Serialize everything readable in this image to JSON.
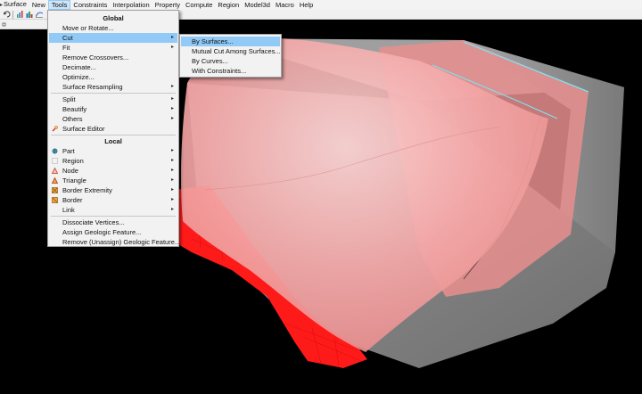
{
  "menubar": {
    "items": [
      "Surface",
      "New",
      "Tools",
      "Constraints",
      "Interpolation",
      "Property",
      "Compute",
      "Region",
      "Model3d",
      "Macro",
      "Help"
    ],
    "active_index": 2
  },
  "tools_menu": {
    "global_header": "Global",
    "local_header": "Local",
    "items": {
      "move_rotate": "Move or Rotate...",
      "cut": "Cut",
      "fit": "Fit",
      "remove_crossovers": "Remove Crossovers...",
      "decimate": "Decimate...",
      "optimize": "Optimize...",
      "surface_resampling": "Surface Resampling",
      "split": "Split",
      "beautify": "Beautify",
      "others": "Others",
      "surface_editor": "Surface Editor",
      "part": "Part",
      "region": "Region",
      "node": "Node",
      "triangle": "Triangle",
      "border_extremity": "Border Extremity",
      "border": "Border",
      "link": "Link",
      "dissociate_vertices": "Dissociate Vertices...",
      "assign_geologic_feature": "Assign Geologic Feature...",
      "remove_geologic_feature": "Remove (Unassign) Geologic Feature..."
    }
  },
  "cut_submenu": {
    "items": [
      "By Surfaces...",
      "Mutual Cut Among Surfaces...",
      "By Curves...",
      "With Constraints..."
    ],
    "highlighted_index": 0
  },
  "icons": {
    "submenu_arrow": "▸",
    "surface_editor": "wrench-icon",
    "part": "globe-icon",
    "region": "region-icon",
    "node": "node-triangle-icon",
    "triangle": "triangle-icon",
    "border_extremity": "border-extremity-icon",
    "border": "border-icon",
    "link": "link-icon"
  },
  "colors": {
    "menu_highlight": "#91c9f7",
    "surface_pink": "#f08c8c",
    "red_surface": "#ff1a1a",
    "box_gray": "#8e8e8e"
  }
}
